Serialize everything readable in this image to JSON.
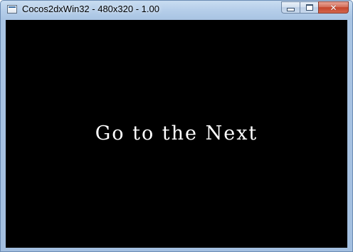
{
  "window": {
    "title": "Cocos2dxWin32 - 480x320 - 1.00",
    "icon": "app-window-icon",
    "controls": {
      "minimize": "minimize-icon",
      "maximize": "maximize-icon",
      "close_glyph": "✕"
    }
  },
  "scene": {
    "label": "Go to the Next"
  },
  "colors": {
    "canvas_background": "#000000",
    "label_text": "#ffffff",
    "close_button": "#c5452c"
  }
}
